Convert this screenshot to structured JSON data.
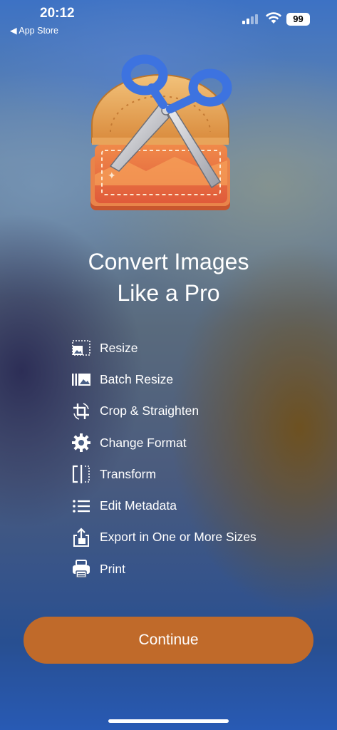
{
  "status_bar": {
    "time": "20:12",
    "back_label": "◀ App Store",
    "battery": "99"
  },
  "hero": {
    "icon": "scissors-over-image-stack-icon",
    "title_line1": "Convert Images",
    "title_line2": "Like a Pro"
  },
  "features": [
    {
      "icon": "resize-icon",
      "label": "Resize"
    },
    {
      "icon": "batch-resize-icon",
      "label": "Batch Resize"
    },
    {
      "icon": "crop-icon",
      "label": "Crop & Straighten"
    },
    {
      "icon": "gear-icon",
      "label": "Change Format"
    },
    {
      "icon": "transform-icon",
      "label": "Transform"
    },
    {
      "icon": "list-icon",
      "label": "Edit Metadata"
    },
    {
      "icon": "export-icon",
      "label": "Export in One or More Sizes"
    },
    {
      "icon": "printer-icon",
      "label": "Print"
    }
  ],
  "continue_label": "Continue",
  "colors": {
    "button": "#c06a2a",
    "text": "#ffffff"
  }
}
